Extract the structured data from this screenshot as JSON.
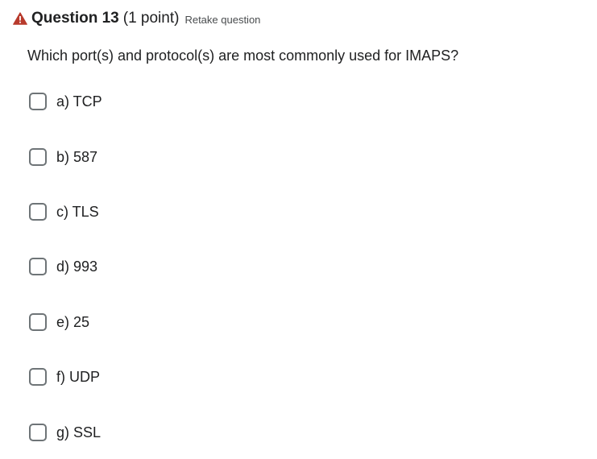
{
  "header": {
    "title": "Question 13",
    "points": "(1 point)",
    "retake_label": "Retake question",
    "warning_icon": "warning-triangle-icon",
    "warning_color": "#c0392b"
  },
  "question": {
    "text": "Which port(s) and protocol(s) are most commonly used for IMAPS?"
  },
  "options": [
    {
      "label": "a)  TCP",
      "checked": false
    },
    {
      "label": "b)  587",
      "checked": false
    },
    {
      "label": "c)  TLS",
      "checked": false
    },
    {
      "label": "d)  993",
      "checked": false
    },
    {
      "label": "e)  25",
      "checked": false
    },
    {
      "label": "f)  UDP",
      "checked": false
    },
    {
      "label": "g)  SSL",
      "checked": false
    }
  ]
}
